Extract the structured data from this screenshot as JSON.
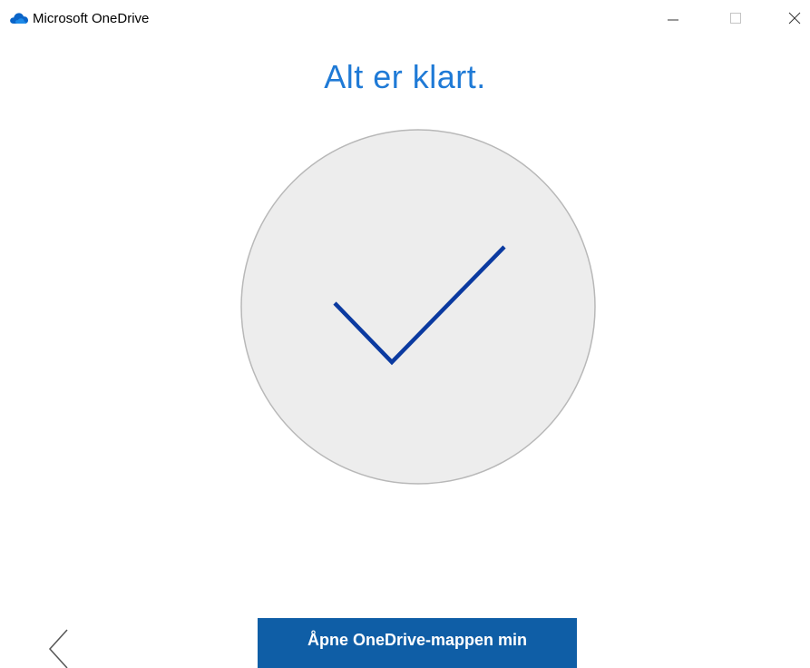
{
  "window": {
    "title": "Microsoft OneDrive",
    "controls": {
      "minimize": "minimize-icon",
      "maximize": "maximize-icon",
      "close": "close-icon"
    }
  },
  "main": {
    "heading": "Alt er klart.",
    "illustration": "checkmark-circle-icon"
  },
  "footer": {
    "back_icon": "chevron-left-icon",
    "open_folder_label": "Åpne OneDrive-mappen min"
  },
  "colors": {
    "heading": "#1f7ad6",
    "checkmark": "#0b3aa0",
    "circle_fill": "#ededed",
    "circle_border": "#b8b8b8",
    "button_bg": "#0f5ea6",
    "button_text": "#ffffff"
  }
}
